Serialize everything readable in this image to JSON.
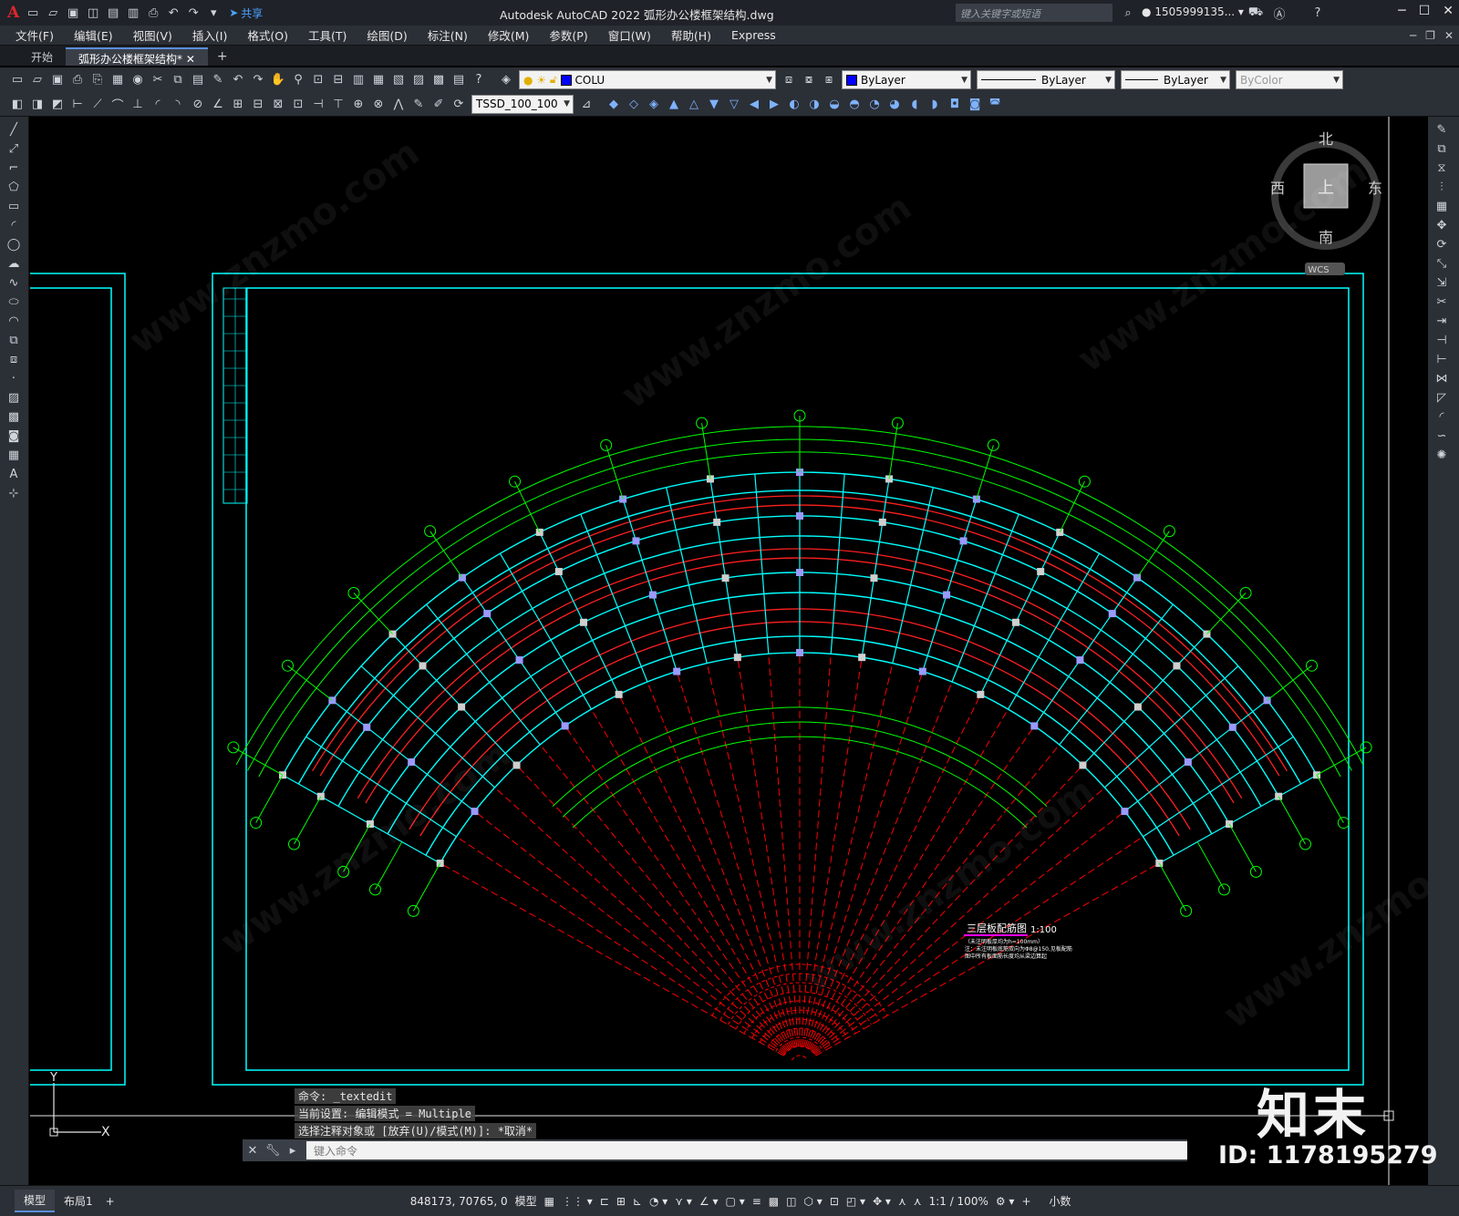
{
  "titlebar": {
    "app_logo": "A",
    "share_label": "共享",
    "title": "Autodesk AutoCAD 2022    弧形办公楼框架结构.dwg",
    "search_placeholder": "键入关键字或短语",
    "username": "1505999135..."
  },
  "menu": [
    "文件(F)",
    "编辑(E)",
    "视图(V)",
    "插入(I)",
    "格式(O)",
    "工具(T)",
    "绘图(D)",
    "标注(N)",
    "修改(M)",
    "参数(P)",
    "窗口(W)",
    "帮助(H)",
    "Express"
  ],
  "tabs": [
    {
      "label": "开始",
      "active": false
    },
    {
      "label": "弧形办公楼框架结构*",
      "active": true
    }
  ],
  "properties": {
    "layer": "COLU",
    "color": "ByLayer",
    "linetype": "ByLayer",
    "lineweight": "ByLayer",
    "plotstyle": "ByColor",
    "dimstyle": "TSSD_100_100"
  },
  "viewcube": {
    "north": "北",
    "south": "南",
    "east": "东",
    "west": "西",
    "face": "上",
    "wcs": "WCS"
  },
  "drawing": {
    "title": "三层板配筋图",
    "scale": "1:100",
    "note_line1": "（未注明板厚均为h=100mm）",
    "note_line2": "注：未注明板底筋双向为Φ8@150,见板配筋",
    "note_line3": "图中所有板面筋长度均从梁边算起"
  },
  "command_history": [
    "命令: _textedit",
    "当前设置: 编辑模式 = Multiple",
    "选择注释对象或 [放弃(U)/模式(M)]: *取消*"
  ],
  "command_placeholder": "键入命令",
  "ucs": {
    "x": "X",
    "y": "Y"
  },
  "status": {
    "layout_tabs": [
      {
        "label": "模型",
        "active": true
      },
      {
        "label": "布局1",
        "active": false
      }
    ],
    "coordinates": "848173, 70765, 0",
    "mode": "模型",
    "scale": "1:1 / 100%",
    "units": "小数"
  },
  "brand": {
    "logo": "知末",
    "id": "ID: 1178195279"
  },
  "colors": {
    "cyan": "#00ffff",
    "green": "#00ff00",
    "red": "#ff0000",
    "ui_dark": "#2b2f36"
  }
}
